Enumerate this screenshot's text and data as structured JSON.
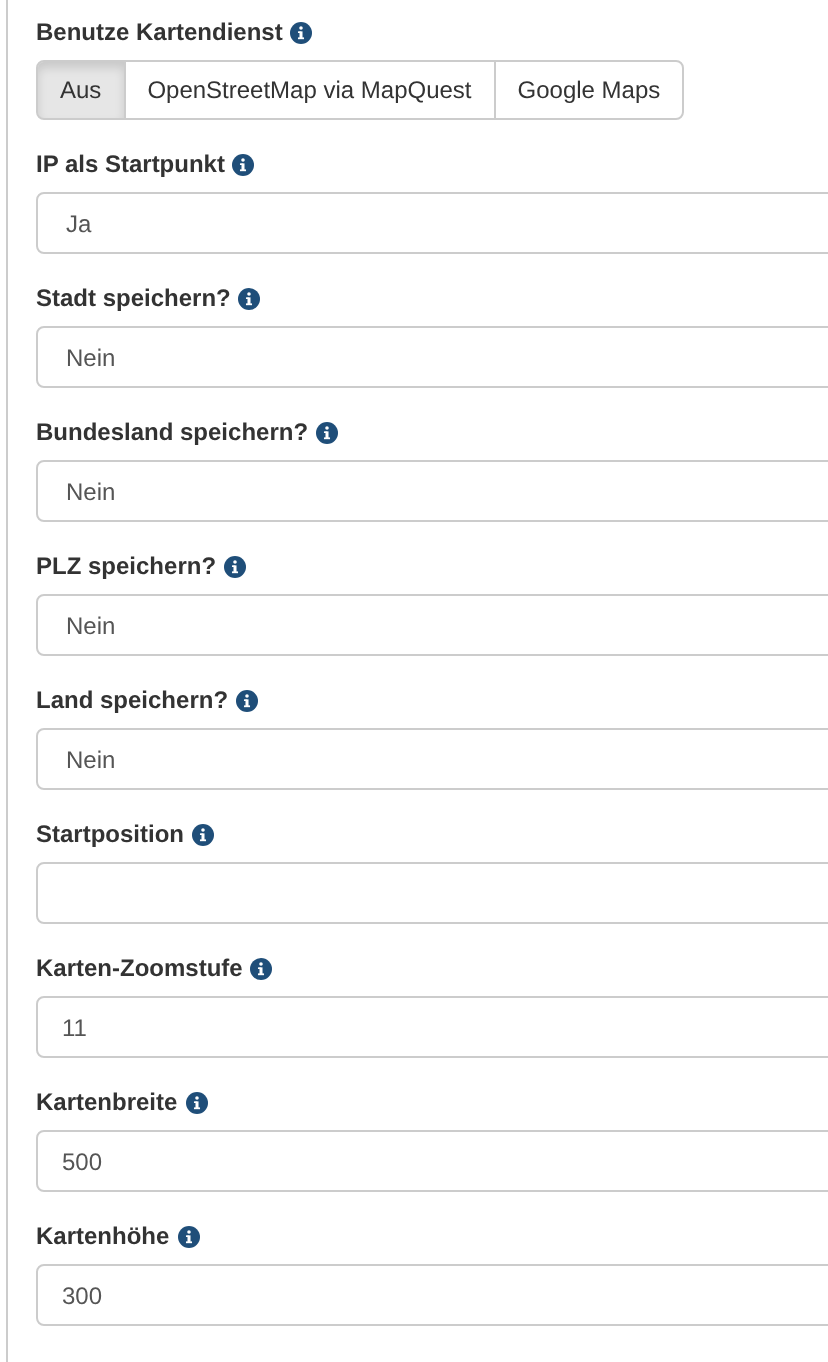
{
  "map_service": {
    "label": "Benutze Kartendienst",
    "options": [
      {
        "label": "Aus",
        "selected": true
      },
      {
        "label": "OpenStreetMap via MapQuest",
        "selected": false
      },
      {
        "label": "Google Maps",
        "selected": false
      }
    ]
  },
  "fields": [
    {
      "label": "IP als Startpunkt",
      "kind": "select",
      "value": "Ja"
    },
    {
      "label": "Stadt speichern?",
      "kind": "select",
      "value": "Nein"
    },
    {
      "label": "Bundesland speichern?",
      "kind": "select",
      "value": "Nein"
    },
    {
      "label": "PLZ speichern?",
      "kind": "select",
      "value": "Nein"
    },
    {
      "label": "Land speichern?",
      "kind": "select",
      "value": "Nein"
    },
    {
      "label": "Startposition",
      "kind": "text"
    },
    {
      "label": "Karten-Zoomstufe",
      "kind": "text",
      "value": "11"
    },
    {
      "label": "Kartenbreite",
      "kind": "text",
      "value": "500"
    },
    {
      "label": "Kartenhöhe",
      "kind": "text",
      "value": "300"
    }
  ]
}
